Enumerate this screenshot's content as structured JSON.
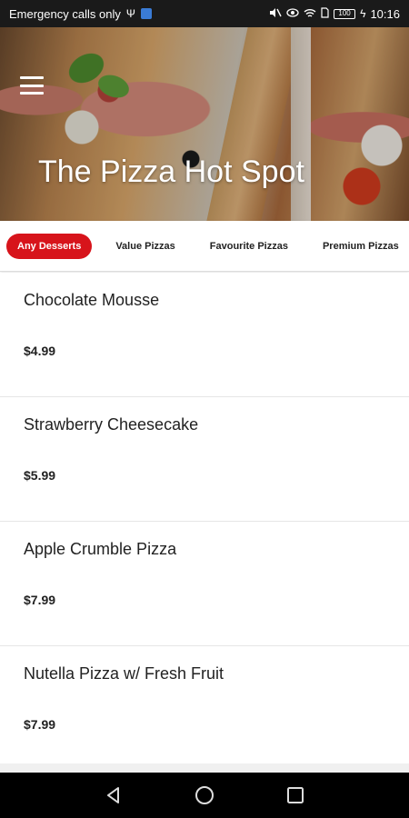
{
  "status_bar": {
    "carrier_text": "Emergency calls only",
    "usb_icon": "usb-icon",
    "sim_icon": "sim-icon",
    "mute_icon": "mute-icon",
    "eye_icon": "eye-icon",
    "wifi_icon": "wifi-icon",
    "battery_level": "100",
    "time": "10:16"
  },
  "header": {
    "menu_icon": "hamburger-menu-icon",
    "title": "The Pizza Hot Spot"
  },
  "tabs": [
    {
      "label": "Any Desserts",
      "active": true
    },
    {
      "label": "Value Pizzas",
      "active": false
    },
    {
      "label": "Favourite Pizzas",
      "active": false
    },
    {
      "label": "Premium Pizzas",
      "active": false
    }
  ],
  "menu_items": [
    {
      "name": "Chocolate Mousse",
      "price": "$4.99"
    },
    {
      "name": "Strawberry Cheesecake",
      "price": "$5.99"
    },
    {
      "name": "Apple Crumble Pizza",
      "price": "$7.99"
    },
    {
      "name": "Nutella Pizza w/ Fresh Fruit",
      "price": "$7.99"
    }
  ],
  "nav_bar": {
    "back_icon": "back-triangle-icon",
    "home_icon": "home-circle-icon",
    "recents_icon": "recents-square-icon"
  },
  "colors": {
    "accent": "#d7141b",
    "status_bar_bg": "#1a1a1a",
    "nav_bar_bg": "#000000"
  }
}
